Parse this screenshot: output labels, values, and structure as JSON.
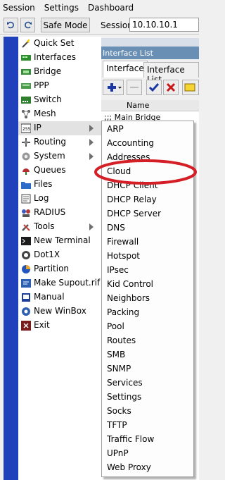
{
  "menubar": {
    "items": [
      "Session",
      "Settings",
      "Dashboard"
    ]
  },
  "toolbar": {
    "undo_icon": "undo-icon",
    "redo_icon": "redo-icon",
    "safe_mode_label": "Safe Mode",
    "session_label": "Session:",
    "session_value": "10.10.10.1"
  },
  "mainmenu": {
    "items": [
      {
        "label": "Quick Set",
        "icon": "quick-set-icon",
        "submenu": false
      },
      {
        "label": "Interfaces",
        "icon": "interfaces-icon",
        "submenu": false
      },
      {
        "label": "Bridge",
        "icon": "bridge-icon",
        "submenu": false
      },
      {
        "label": "PPP",
        "icon": "ppp-icon",
        "submenu": false
      },
      {
        "label": "Switch",
        "icon": "switch-icon",
        "submenu": false
      },
      {
        "label": "Mesh",
        "icon": "mesh-icon",
        "submenu": false
      },
      {
        "label": "IP",
        "icon": "ip-icon",
        "submenu": true,
        "active": true
      },
      {
        "label": "Routing",
        "icon": "routing-icon",
        "submenu": true
      },
      {
        "label": "System",
        "icon": "system-icon",
        "submenu": true
      },
      {
        "label": "Queues",
        "icon": "queues-icon",
        "submenu": false
      },
      {
        "label": "Files",
        "icon": "files-icon",
        "submenu": false
      },
      {
        "label": "Log",
        "icon": "log-icon",
        "submenu": false
      },
      {
        "label": "RADIUS",
        "icon": "radius-icon",
        "submenu": false
      },
      {
        "label": "Tools",
        "icon": "tools-icon",
        "submenu": true
      },
      {
        "label": "New Terminal",
        "icon": "terminal-icon",
        "submenu": false
      },
      {
        "label": "Dot1X",
        "icon": "dot1x-icon",
        "submenu": false
      },
      {
        "label": "Partition",
        "icon": "partition-icon",
        "submenu": false
      },
      {
        "label": "Make Supout.rif",
        "icon": "supout-icon",
        "submenu": false
      },
      {
        "label": "Manual",
        "icon": "manual-icon",
        "submenu": false
      },
      {
        "label": "New WinBox",
        "icon": "winbox-icon",
        "submenu": false
      },
      {
        "label": "Exit",
        "icon": "exit-icon",
        "submenu": false
      }
    ]
  },
  "interface_window": {
    "caption": "Interface List",
    "tabs": [
      "Interface",
      "Interface List"
    ],
    "column_header": "Name",
    "row_1": ";;; Main Bridge"
  },
  "ip_submenu": {
    "items": [
      "ARP",
      "Accounting",
      "Addresses",
      "Cloud",
      "DHCP Client",
      "DHCP Relay",
      "DHCP Server",
      "DNS",
      "Firewall",
      "Hotspot",
      "IPsec",
      "Kid Control",
      "Neighbors",
      "Packing",
      "Pool",
      "Routes",
      "SMB",
      "SNMP",
      "Services",
      "Settings",
      "Socks",
      "TFTP",
      "Traffic Flow",
      "UPnP",
      "Web Proxy"
    ]
  },
  "colors": {
    "sidebar": "#2040bc",
    "highlight": "#d41f26",
    "caption": "#6a8fb5"
  }
}
